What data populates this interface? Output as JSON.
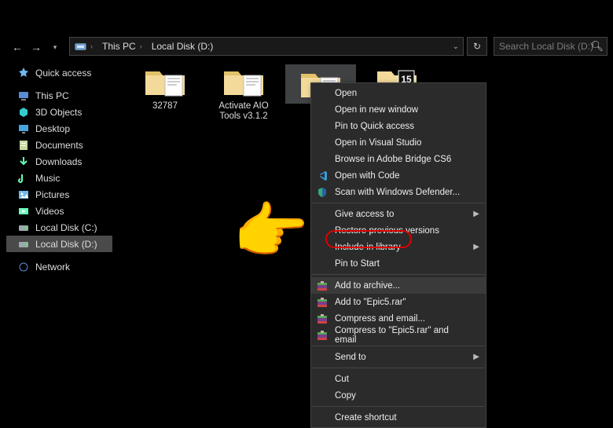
{
  "toolbar": {
    "back": "←",
    "forward": "→",
    "up": "↑"
  },
  "address": {
    "root": "This PC",
    "drive": "Local Disk (D:)",
    "refresh_tip": "Refresh",
    "dropdown_tip": "Previous locations"
  },
  "search": {
    "placeholder": "Search Local Disk (D:)"
  },
  "sidebar": {
    "items": [
      {
        "label": "Quick access",
        "icon": "star"
      },
      {
        "label": "This PC",
        "icon": "pc"
      },
      {
        "label": "3D Objects",
        "icon": "3d"
      },
      {
        "label": "Desktop",
        "icon": "desktop"
      },
      {
        "label": "Documents",
        "icon": "doc"
      },
      {
        "label": "Downloads",
        "icon": "down"
      },
      {
        "label": "Music",
        "icon": "music"
      },
      {
        "label": "Pictures",
        "icon": "pic"
      },
      {
        "label": "Videos",
        "icon": "video"
      },
      {
        "label": "Local Disk (C:)",
        "icon": "disk"
      },
      {
        "label": "Local Disk (D:)",
        "icon": "disk"
      },
      {
        "label": "Network",
        "icon": "net"
      }
    ],
    "selected": 10
  },
  "folders": [
    {
      "label": "32787"
    },
    {
      "label": "Activate AIO Tools v3.1.2"
    },
    {
      "label": ""
    },
    {
      "label": ""
    }
  ],
  "folder_selected": 2,
  "menu": {
    "groups": [
      [
        {
          "label": "Open"
        },
        {
          "label": "Open in new window"
        },
        {
          "label": "Pin to Quick access"
        },
        {
          "label": "Open in Visual Studio"
        },
        {
          "label": "Browse in Adobe Bridge CS6"
        },
        {
          "label": "Open with Code",
          "icon": "vscode"
        },
        {
          "label": "Scan with Windows Defender...",
          "icon": "shield"
        }
      ],
      [
        {
          "label": "Give access to",
          "sub": true
        },
        {
          "label": "Restore previous versions"
        },
        {
          "label": "Include in library",
          "sub": true
        },
        {
          "label": "Pin to Start"
        }
      ],
      [
        {
          "label": "Add to archive...",
          "icon": "rar",
          "hl": true
        },
        {
          "label": "Add to \"Epic5.rar\"",
          "icon": "rar"
        },
        {
          "label": "Compress and email...",
          "icon": "rar"
        },
        {
          "label": "Compress to \"Epic5.rar\" and email",
          "icon": "rar"
        }
      ],
      [
        {
          "label": "Send to",
          "sub": true
        }
      ],
      [
        {
          "label": "Cut"
        },
        {
          "label": "Copy"
        }
      ],
      [
        {
          "label": "Create shortcut"
        }
      ]
    ]
  }
}
